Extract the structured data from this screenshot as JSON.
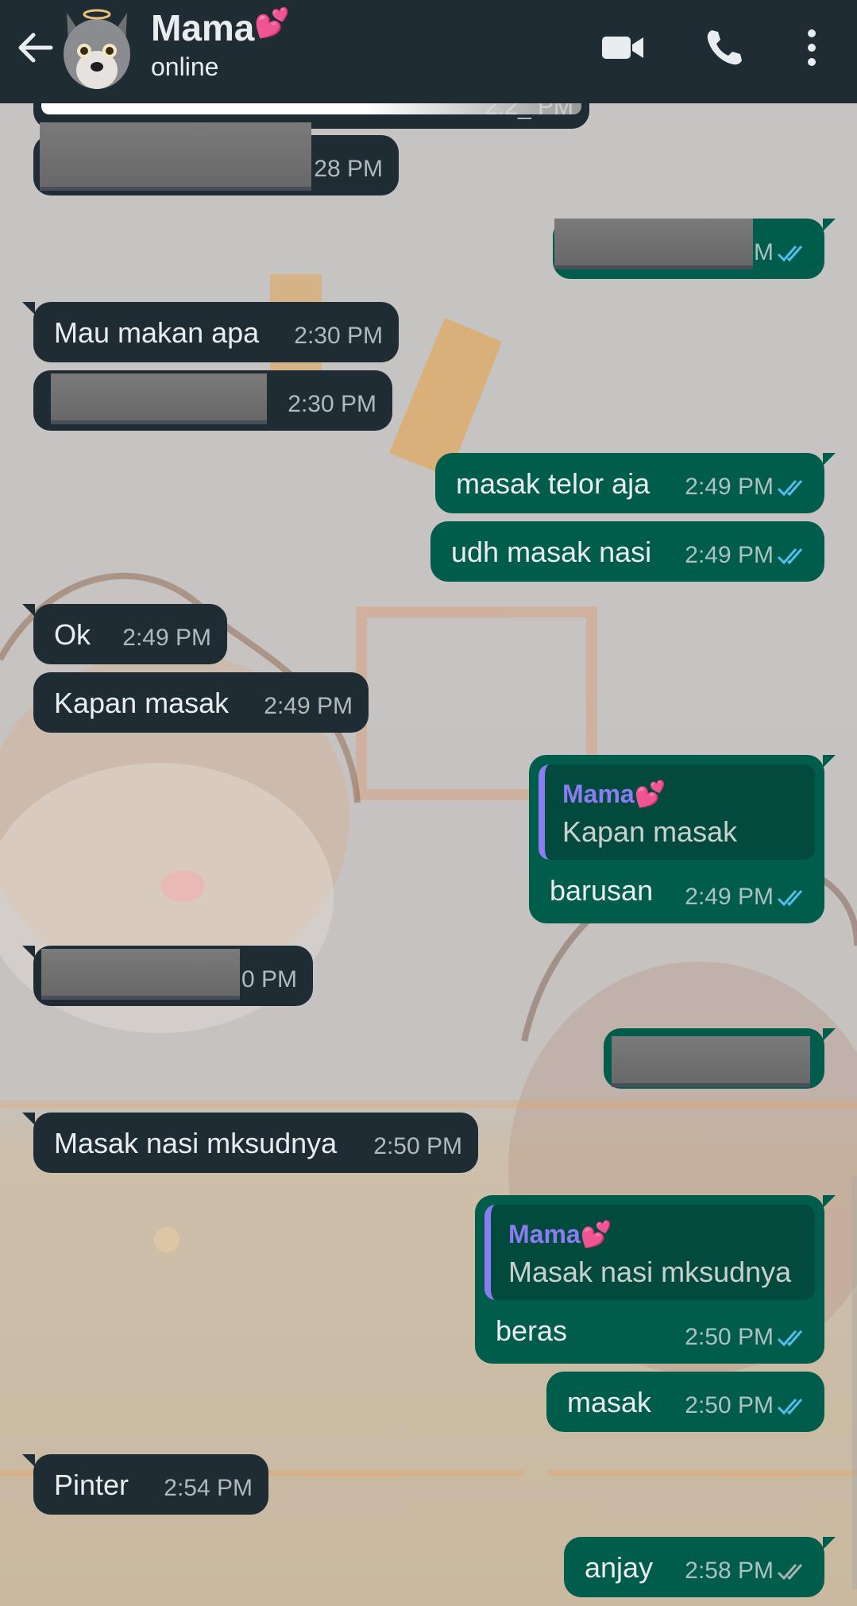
{
  "header": {
    "contact_name": "Mama",
    "name_emoji": "💕",
    "status": "online",
    "icons": [
      "back-arrow-icon",
      "avatar",
      "video-call-icon",
      "voice-call-icon",
      "more-options-icon"
    ]
  },
  "colors": {
    "header_bg": "#1f2c34",
    "incoming_bubble": "#1f2c34",
    "outgoing_bubble": "#005c4b",
    "read_ticks": "#53bdeb",
    "quote_name": "#8b7cf2"
  },
  "messages": [
    {
      "dir": "in",
      "text": "",
      "time": "2:2_ PM",
      "redacted": true
    },
    {
      "dir": "in",
      "text": "",
      "time": "28 PM",
      "redacted": true
    },
    {
      "dir": "out",
      "text": "",
      "time": "M",
      "redacted": true
    },
    {
      "dir": "in",
      "text": "Mau makan apa",
      "time": "2:30 PM"
    },
    {
      "dir": "in",
      "text": "",
      "time": "2:30 PM",
      "redacted": true
    },
    {
      "dir": "out",
      "text": "masak telor aja",
      "time": "2:49 PM"
    },
    {
      "dir": "out",
      "text": "udh masak nasi",
      "time": "2:49 PM"
    },
    {
      "dir": "in",
      "text": "Ok",
      "time": "2:49 PM"
    },
    {
      "dir": "in",
      "text": "Kapan masak",
      "time": "2:49 PM"
    },
    {
      "dir": "out",
      "text": "barusan",
      "time": "2:49 PM",
      "quote": {
        "name": "Mama💕",
        "text": "Kapan masak"
      }
    },
    {
      "dir": "in",
      "text": "",
      "time": "0 PM",
      "redacted": true
    },
    {
      "dir": "out",
      "text": "",
      "time": "",
      "redacted": true
    },
    {
      "dir": "in",
      "text": "Masak nasi mksudnya",
      "time": "2:50 PM"
    },
    {
      "dir": "out",
      "text": "beras",
      "time": "2:50 PM",
      "quote": {
        "name": "Mama💕",
        "text": "Masak nasi mksudnya"
      }
    },
    {
      "dir": "out",
      "text": "masak",
      "time": "2:50 PM"
    },
    {
      "dir": "in",
      "text": "Pinter",
      "time": "2:54 PM"
    },
    {
      "dir": "out",
      "text": "anjay",
      "time": "2:58 PM"
    }
  ]
}
